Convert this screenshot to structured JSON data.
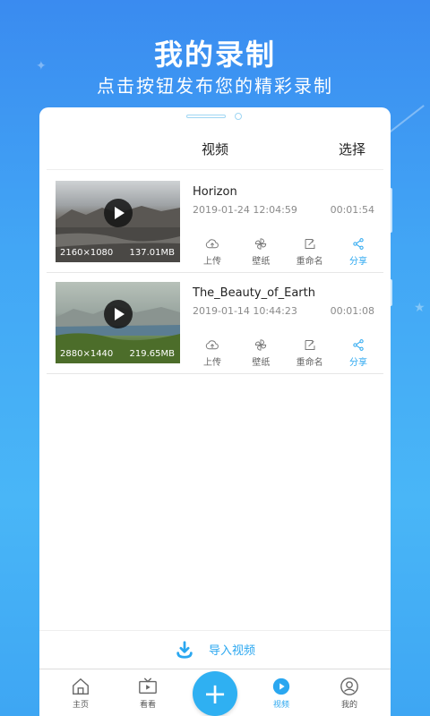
{
  "promo": {
    "title": "我的录制",
    "subtitle": "点击按钮发布您的精彩录制"
  },
  "header": {
    "title": "视频",
    "select_label": "选择"
  },
  "videos": [
    {
      "title": "Horizon",
      "date": "2019-01-24 12:04:59",
      "duration": "00:01:54",
      "resolution": "2160×1080",
      "size": "137.01MB"
    },
    {
      "title": "The_Beauty_of_Earth",
      "date": "2019-01-14 10:44:23",
      "duration": "00:01:08",
      "resolution": "2880×1440",
      "size": "219.65MB"
    }
  ],
  "actions": {
    "upload": "上传",
    "wallpaper": "壁纸",
    "rename": "重命名",
    "share": "分享"
  },
  "import_label": "导入视频",
  "tabs": [
    {
      "label": "主页",
      "icon": "home-icon"
    },
    {
      "label": "看看",
      "icon": "tv-icon"
    },
    {
      "label": "视频",
      "icon": "play-circle-icon",
      "active": true
    },
    {
      "label": "我的",
      "icon": "profile-icon"
    }
  ],
  "fab_icon": "plus-icon",
  "colors": {
    "accent": "#2aa7f0",
    "background_top": "#3a8bf0",
    "background_bottom": "#49b6f7"
  }
}
